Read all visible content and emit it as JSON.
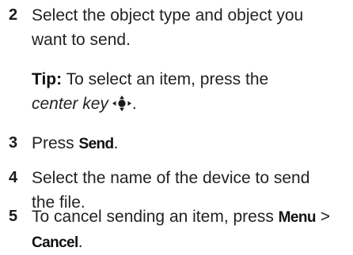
{
  "steps": [
    {
      "number": "2",
      "lines": [
        "Select the object type and object you",
        "want to send."
      ]
    },
    {
      "number": "3",
      "text_before": "Press ",
      "key": "Send",
      "text_after": "."
    },
    {
      "number": "4",
      "lines": [
        "Select the name of the device to send",
        "the file."
      ]
    },
    {
      "number": "5",
      "line1_text": "To cancel sending an item, press ",
      "line1_key": "Menu",
      "line1_after": " >",
      "line2_key": "Cancel",
      "line2_after": "."
    }
  ],
  "tip": {
    "label": "Tip:",
    "line1": " To select an item, press the",
    "italic": "center key",
    "after_icon": ".",
    "icon": "center-nav-key-icon"
  }
}
